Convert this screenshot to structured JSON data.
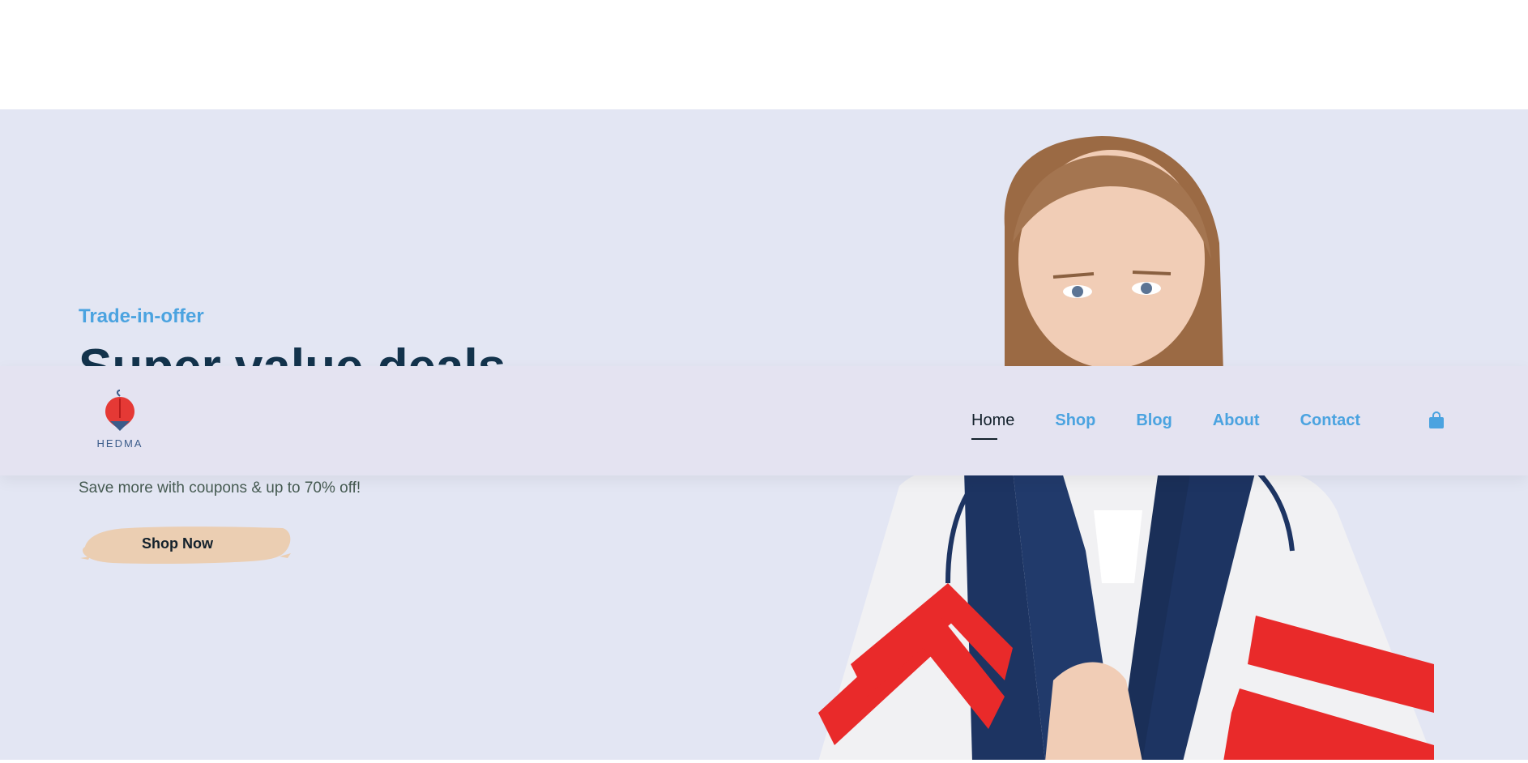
{
  "hero": {
    "eyebrow": "Trade-in-offer",
    "headline": "Super value deals",
    "subtext": "Save more with coupons & up to 70% off!",
    "cta_label": "Shop Now",
    "background": "#e3e6f3",
    "cta_color": "#ebceb2"
  },
  "navbar": {
    "logo_text": "HEDMA",
    "items": [
      {
        "label": "Home",
        "active": true
      },
      {
        "label": "Shop",
        "active": false
      },
      {
        "label": "Blog",
        "active": false
      },
      {
        "label": "About",
        "active": false
      },
      {
        "label": "Contact",
        "active": false
      }
    ],
    "cart_icon": "shopping-bag-icon",
    "accent": "#4ba3e0",
    "dark": "#13212c"
  }
}
